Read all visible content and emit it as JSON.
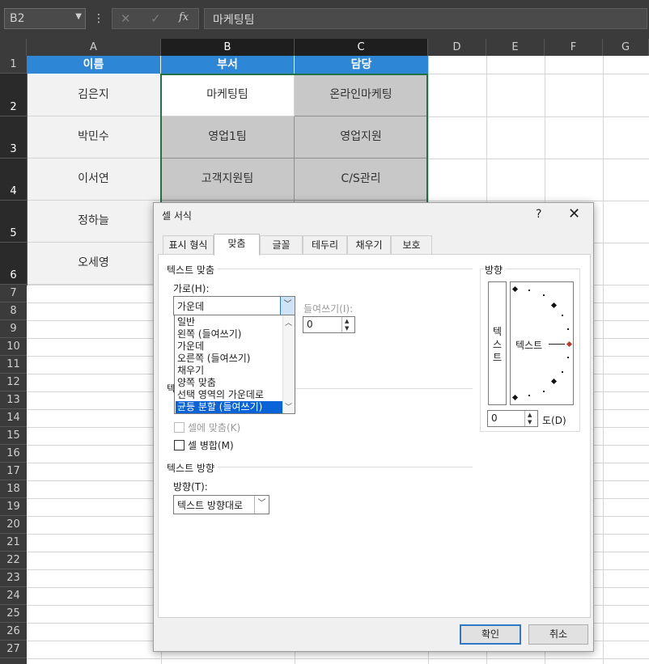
{
  "formula_bar": {
    "name_box": "B2",
    "kebab": "⋮",
    "cancel_symbol": "✕",
    "enter_symbol": "✓",
    "fx_symbol": "fx",
    "value": "마케팅팀"
  },
  "columns": [
    "A",
    "B",
    "C",
    "D",
    "E",
    "F",
    "G"
  ],
  "rows": [
    "1",
    "2",
    "3",
    "4",
    "5",
    "6",
    "7",
    "8",
    "9",
    "10",
    "11",
    "12",
    "13",
    "14",
    "15",
    "16",
    "17",
    "18",
    "19",
    "20",
    "21",
    "22",
    "23",
    "24",
    "25",
    "26",
    "27"
  ],
  "table": {
    "headers": [
      "이름",
      "부서",
      "담당"
    ],
    "rows": [
      [
        "김은지",
        "마케팅팀",
        "온라인마케팅"
      ],
      [
        "박민수",
        "영업1팀",
        "영업지원"
      ],
      [
        "이서연",
        "고객지원팀",
        "C/S관리"
      ],
      [
        "정하늘",
        "",
        ""
      ],
      [
        "오세영",
        "",
        ""
      ]
    ]
  },
  "colors": {
    "header_fill": "#2e86d6",
    "cell_fill_gray": "#c8c8c8",
    "cell_fill_light": "#f2f2f2",
    "selection": "#217346",
    "dialog_accent": "#0a64d8"
  },
  "dialog": {
    "title": "셀 서식",
    "help": "?",
    "close": "✕",
    "tabs": [
      "표시 형식",
      "맞춤",
      "글꼴",
      "테두리",
      "채우기",
      "보호"
    ],
    "active_tab": "맞춤",
    "text_alignment": {
      "group_label": "텍스트 맞춤",
      "horizontal_label": "가로(H):",
      "horizontal_value": "가운데",
      "indent_label": "들여쓰기(I):",
      "indent_value": "0",
      "horizontal_options": [
        "일반",
        "왼쪽 (들여쓰기)",
        "가운데",
        "오른쪽 (들여쓰기)",
        "채우기",
        "양쪽 맞춤",
        "선택 영역의 가운데로",
        "균등 분할 (들여쓰기)"
      ],
      "selected_option": "균등 분할 (들여쓰기)",
      "hidden_group_letter": "텍"
    },
    "text_control": {
      "shrink_label": "셀에 맞춤(K)",
      "merge_label": "셀 병합(M)"
    },
    "direction": {
      "group_label": "텍스트 방향",
      "label": "방향(T):",
      "value": "텍스트 방향대로"
    },
    "orientation": {
      "group_label": "방향",
      "vertical_text": [
        "텍",
        "스",
        "트"
      ],
      "dial_text": "텍스트",
      "degrees_value": "0",
      "degrees_label": "도(D)"
    },
    "ok_label": "확인",
    "cancel_label": "취소"
  }
}
